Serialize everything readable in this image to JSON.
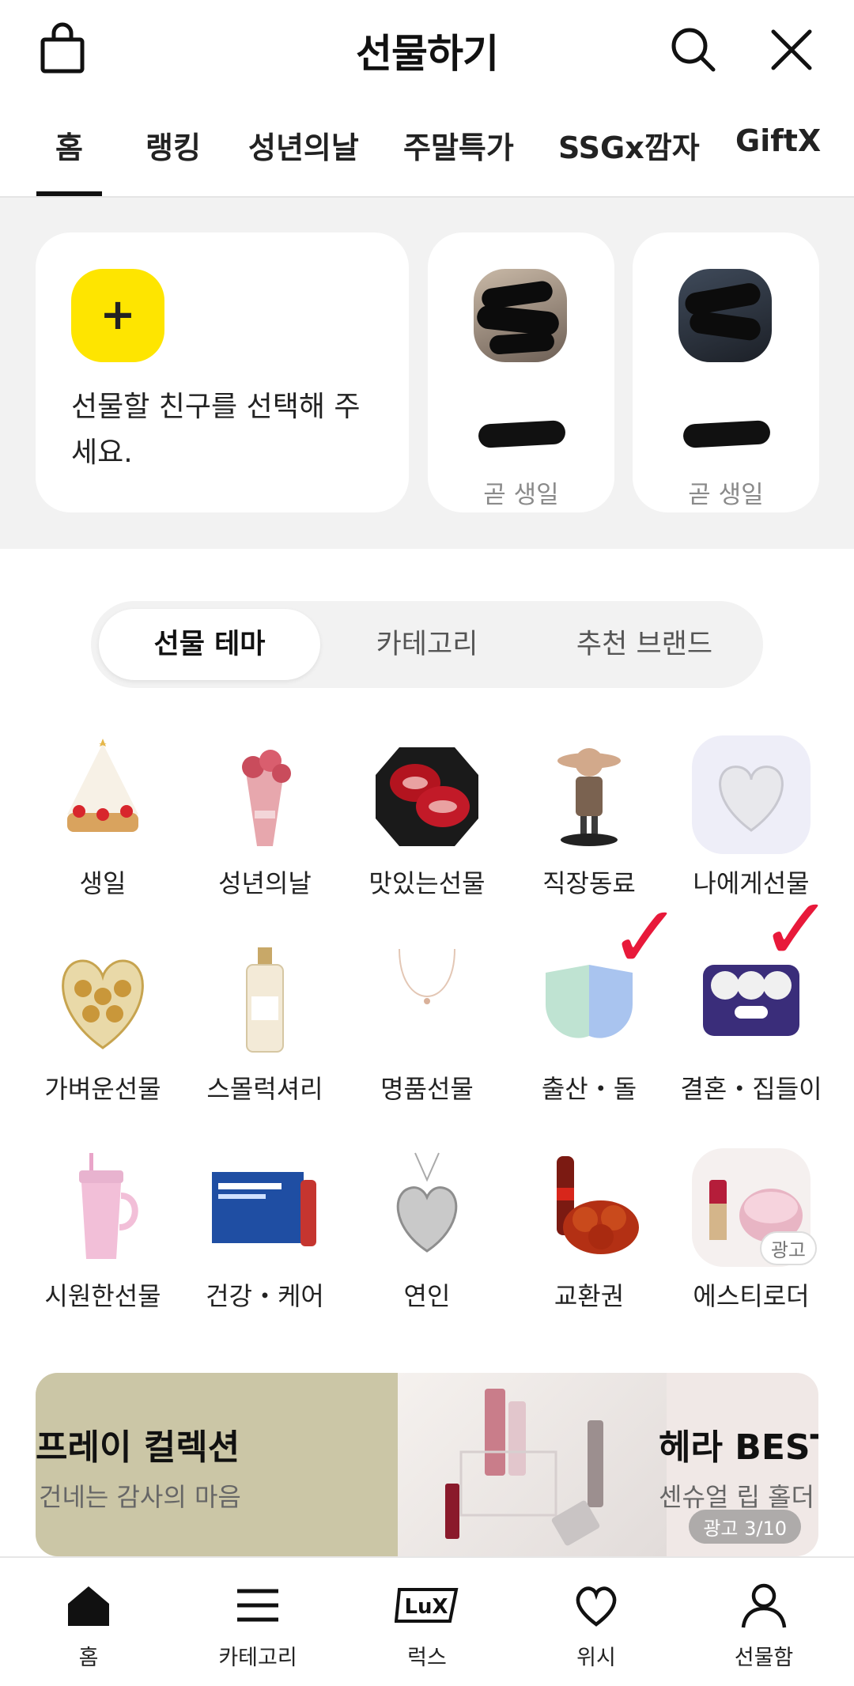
{
  "header": {
    "title": "선물하기",
    "icons": [
      "shopping-bag-icon",
      "search-icon",
      "close-icon"
    ]
  },
  "tabs": [
    {
      "label": "홈",
      "active": true
    },
    {
      "label": "랭킹"
    },
    {
      "label": "성년의날"
    },
    {
      "label": "주말특가"
    },
    {
      "label": "SSGx깜자"
    },
    {
      "label": "GiftX"
    }
  ],
  "friends": {
    "add_text": "선물할 친구를 선택해 주세요.",
    "add_icon": "plus-icon",
    "add_color": "#fee500",
    "list": [
      {
        "status": "곧 생일"
      },
      {
        "status": "곧 생일"
      }
    ]
  },
  "segment": [
    {
      "label": "선물 테마",
      "active": true
    },
    {
      "label": "카테고리"
    },
    {
      "label": "추천 브랜드"
    }
  ],
  "themes": [
    {
      "label": "생일"
    },
    {
      "label": "성년의날"
    },
    {
      "label": "맛있는선물"
    },
    {
      "label": "직장동료"
    },
    {
      "label": "나에게선물"
    },
    {
      "label": "가벼운선물"
    },
    {
      "label": "스몰럭셔리"
    },
    {
      "label": "명품선물"
    },
    {
      "label": "출산・돌"
    },
    {
      "label": "결혼・집들이"
    },
    {
      "label": "시원한선물"
    },
    {
      "label": "건강・케어"
    },
    {
      "label": "연인"
    },
    {
      "label": "교환권"
    },
    {
      "label": "에스티로더",
      "badge": "광고"
    }
  ],
  "banner": {
    "left_title": "프레이 컬렉션",
    "left_sub": "건네는 감사의 마음",
    "right_title": "헤라 BEST",
    "right_sub": "센슈얼 립 홀더",
    "counter": "광고 3/10"
  },
  "bottom_nav": [
    {
      "label": "홈",
      "icon": "home-icon"
    },
    {
      "label": "카테고리",
      "icon": "menu-icon"
    },
    {
      "label": "럭스",
      "icon": "lux-icon"
    },
    {
      "label": "위시",
      "icon": "heart-icon"
    },
    {
      "label": "선물함",
      "icon": "person-icon"
    }
  ]
}
